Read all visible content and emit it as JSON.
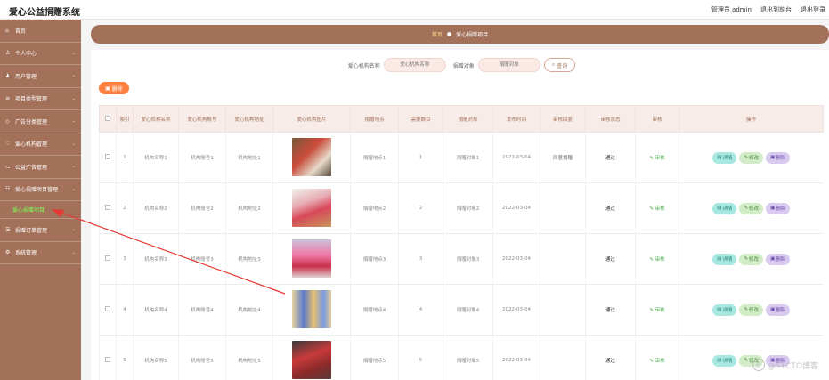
{
  "app": {
    "title": "爱心公益捐赠系统"
  },
  "top_links": [
    "管理员 admin",
    "退出到前台",
    "退出登录"
  ],
  "sidebar": {
    "items": [
      {
        "label": "首页",
        "icon": "home-icon",
        "glyph": "⌂"
      },
      {
        "label": "个人中心",
        "icon": "user-icon",
        "glyph": "♙"
      },
      {
        "label": "用户管理",
        "icon": "users-icon",
        "glyph": "♟"
      },
      {
        "label": "项目类型管理",
        "icon": "list-icon",
        "glyph": "≡"
      },
      {
        "label": "广告分类管理",
        "icon": "tag-icon",
        "glyph": "◇"
      },
      {
        "label": "爱心机构管理",
        "icon": "heart-icon",
        "glyph": "♡"
      },
      {
        "label": "公益广告管理",
        "icon": "ad-icon",
        "glyph": "▭"
      },
      {
        "label": "爱心捐赠项目管理",
        "icon": "project-icon",
        "glyph": "☷"
      }
    ],
    "active_sub": "爱心捐赠项目",
    "items_after": [
      {
        "label": "捐赠订单管理",
        "icon": "order-icon",
        "glyph": "☰"
      },
      {
        "label": "系统管理",
        "icon": "settings-icon",
        "glyph": "⚙"
      }
    ]
  },
  "breadcrumb": {
    "home": "首页",
    "current": "爱心捐赠项目"
  },
  "search": {
    "label1": "爱心机构名称",
    "placeholder1": "爱心机构名称",
    "label2": "捐赠对象",
    "placeholder2": "捐赠对象",
    "query_button": "查询"
  },
  "delete_button": "删除",
  "table": {
    "headers": [
      "索引",
      "爱心机构名称",
      "爱心机构账号",
      "爱心机构地址",
      "爱心机构图片",
      "捐赠地点",
      "需要数目",
      "捐赠对象",
      "发布时间",
      "审核回复",
      "审核状态",
      "审核",
      "操作"
    ],
    "rows": [
      {
        "index": "1",
        "name": "机构名称1",
        "account": "机构账号1",
        "address": "机构地址1",
        "place": "捐赠地点1",
        "count": "1",
        "target": "捐赠对象1",
        "time": "2022-03-04",
        "reply": "同意捐赠",
        "status": "通过",
        "audit": "审核"
      },
      {
        "index": "2",
        "name": "机构名称2",
        "account": "机构账号2",
        "address": "机构地址2",
        "place": "捐赠地点2",
        "count": "2",
        "target": "捐赠对象2",
        "time": "2022-03-04",
        "reply": "",
        "status": "通过",
        "audit": "审核"
      },
      {
        "index": "3",
        "name": "机构名称3",
        "account": "机构账号3",
        "address": "机构地址3",
        "place": "捐赠地点3",
        "count": "3",
        "target": "捐赠对象3",
        "time": "2022-03-04",
        "reply": "",
        "status": "通过",
        "audit": "审核"
      },
      {
        "index": "4",
        "name": "机构名称4",
        "account": "机构账号4",
        "address": "机构地址4",
        "place": "捐赠地点4",
        "count": "4",
        "target": "捐赠对象4",
        "time": "2022-03-04",
        "reply": "",
        "status": "通过",
        "audit": "审核"
      },
      {
        "index": "5",
        "name": "机构名称5",
        "account": "机构账号5",
        "address": "机构地址5",
        "place": "捐赠地点5",
        "count": "5",
        "target": "捐赠对象5",
        "time": "2022-03-04",
        "reply": "",
        "status": "通过",
        "audit": "审核"
      }
    ],
    "ops": {
      "detail": "详情",
      "edit": "修改",
      "delete": "删除"
    }
  },
  "watermark": "@51CTO博客",
  "colors": {
    "brand": "#a3715a",
    "danger": "#ff7f3f",
    "arrow": "#e53935"
  }
}
